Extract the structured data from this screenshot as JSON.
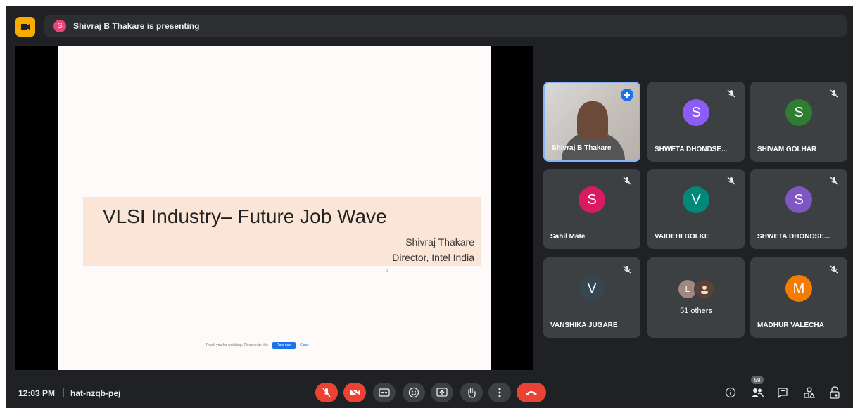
{
  "topbar": {
    "presenter_initial": "S",
    "presenting_text": "Shivraj B Thakare is presenting"
  },
  "slide": {
    "title": "VLSI Industry– Future Job Wave",
    "author": "Shivraj Thakare",
    "role": "Director, Intel India",
    "notice_text": "Thank you for watching. Please rate this",
    "notice_button": "Rate now",
    "notice_close": "Close"
  },
  "participants": [
    {
      "name": "Shivraj B Thakare",
      "type": "video",
      "speaking": true
    },
    {
      "name": "SHWETA DHONDSE...",
      "initial": "S",
      "color": "#8b5cf6",
      "muted": true
    },
    {
      "name": "SHIVAM GOLHAR",
      "initial": "S",
      "color": "#2e7d32",
      "muted": true
    },
    {
      "name": "Sahil Mate",
      "initial": "S",
      "color": "#d81b60",
      "muted": true
    },
    {
      "name": "VAIDEHI BOLKE",
      "initial": "V",
      "color": "#00897b",
      "muted": true
    },
    {
      "name": "SHWETA DHONDSE...",
      "initial": "S",
      "color": "#7e57c2",
      "muted": true
    },
    {
      "name": "VANSHIKA JUGARE",
      "initial": "V",
      "color": "#37474f",
      "muted": true
    },
    {
      "name": "51 others",
      "type": "others",
      "avatars": [
        "L",
        ""
      ],
      "avatar_colors": [
        "#a1887f",
        "#5d4037"
      ]
    },
    {
      "name": "MADHUR VALECHA",
      "initial": "M",
      "color": "#f57c00",
      "muted": true
    }
  ],
  "bottom": {
    "time": "12:03 PM",
    "meeting_code": "hat-nzqb-pej",
    "people_count": "59"
  },
  "colors": {
    "background": "#202124",
    "tile": "#3c4043",
    "danger": "#ea4335",
    "accent": "#1a73e8"
  }
}
